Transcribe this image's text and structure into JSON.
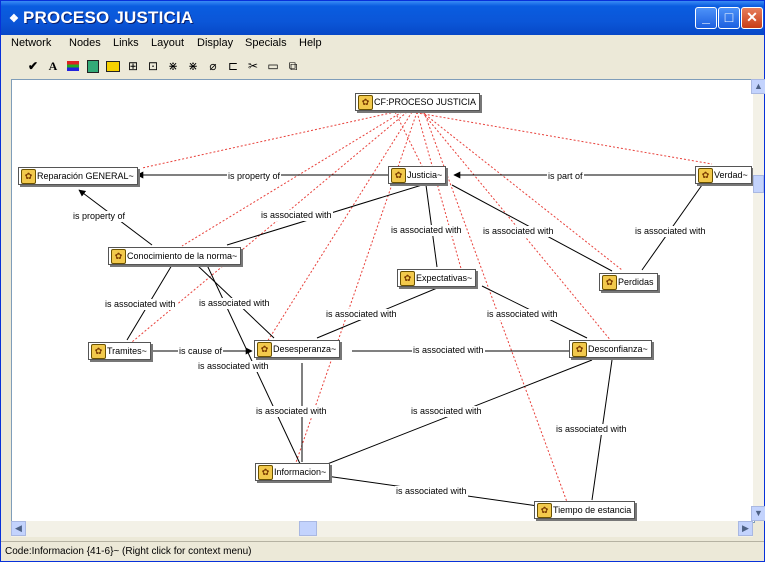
{
  "window": {
    "title": "PROCESO JUSTICIA",
    "title_icon": "network-icon"
  },
  "menu": [
    "Network",
    "Nodes",
    "Links",
    "Layout",
    "Display",
    "Specials",
    "Help"
  ],
  "toolbar_icons": [
    "check-icon",
    "text-a-icon",
    "color-bars-icon",
    "image-icon",
    "yellow-box-icon",
    "layout-1-icon",
    "layout-2-icon",
    "layout-3-icon",
    "layout-4-icon",
    "eraser-icon",
    "connect-icon",
    "cut-icon",
    "box-icon",
    "copy-icon"
  ],
  "nodes": {
    "root": "CF:PROCESO JUSTICIA",
    "reparacion": "Reparación GENERAL~",
    "justicia": "Justicia~",
    "verdad": "Verdad~",
    "conocimiento": "Conocimiento de la norma~",
    "expectativas": "Expectativas~",
    "perdidas": "Perdidas",
    "tramites": "Tramites~",
    "desesperanza": "Desesperanza~",
    "desconfianza": "Desconfianza~",
    "informacion": "Informacion~",
    "tiempo": "Tiempo de estancia"
  },
  "edge_labels": {
    "prop1": "is property of",
    "partof": "is part of",
    "prop2": "is property of",
    "assoc1": "is associated with",
    "assoc2": "is associated with",
    "assoc3": "is associated with",
    "assoc4": "is associated with",
    "assoc5": "is associated with",
    "assoc6": "is associated with",
    "assoc7": "is associated with",
    "assoc8": "is associated with",
    "causeof": "is cause of",
    "assoc9": "is associated with",
    "assoc10": "is associated with",
    "assoc11": "is associated with",
    "assoc12": "is associated with",
    "assoc13": "is associated with",
    "assoc14": "is associated with"
  },
  "status": "Code:Informacion {41-6}~ (Right click for context menu)",
  "colors": {
    "dashed_link": "#e8413b",
    "solid_link": "#000000",
    "title_bar": "#0a5de0"
  }
}
